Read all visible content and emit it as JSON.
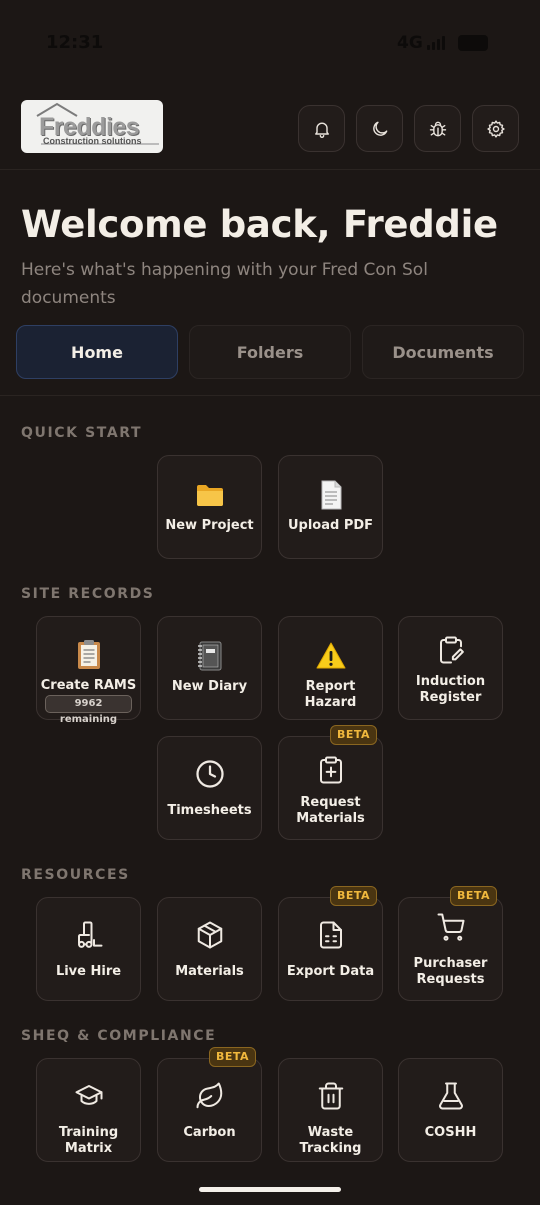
{
  "status_bar": {
    "time": "12:31",
    "network": "4G"
  },
  "header": {
    "logo": {
      "name": "Freddies",
      "tagline": "Construction solutions"
    },
    "buttons": [
      {
        "name": "notifications-button",
        "icon": "bell-icon"
      },
      {
        "name": "dark-mode-button",
        "icon": "moon-icon"
      },
      {
        "name": "bug-report-button",
        "icon": "bug-icon"
      },
      {
        "name": "settings-button",
        "icon": "gear-icon"
      }
    ]
  },
  "welcome": {
    "title": "Welcome back, Freddie",
    "subtitle": "Here's what's happening with your Fred Con Sol documents"
  },
  "tabs": [
    {
      "label": "Home",
      "active": true
    },
    {
      "label": "Folders",
      "active": false
    },
    {
      "label": "Documents",
      "active": false
    }
  ],
  "sections": {
    "quick_start": {
      "title": "QUICK START",
      "items": [
        {
          "label": "New Project",
          "icon": "folder-icon"
        },
        {
          "label": "Upload PDF",
          "icon": "document-icon"
        }
      ]
    },
    "site_records": {
      "title": "SITE RECORDS",
      "items": [
        {
          "label": "Create RAMS",
          "icon": "clipboard-icon",
          "badge": "9962 remaining"
        },
        {
          "label": "New Diary",
          "icon": "notebook-icon"
        },
        {
          "label": "Report Hazard",
          "icon": "warning-icon"
        },
        {
          "label": "Induction Register",
          "icon": "clipboard-edit-icon"
        },
        {
          "label": "Timesheets",
          "icon": "clock-icon"
        },
        {
          "label": "Request Materials",
          "icon": "clipboard-plus-icon",
          "beta": "BETA"
        }
      ]
    },
    "resources": {
      "title": "RESOURCES",
      "items": [
        {
          "label": "Live Hire",
          "icon": "forklift-icon"
        },
        {
          "label": "Materials",
          "icon": "box-icon"
        },
        {
          "label": "Export Data",
          "icon": "spreadsheet-icon",
          "beta": "BETA"
        },
        {
          "label": "Purchaser Requests",
          "icon": "cart-icon",
          "beta": "BETA"
        }
      ]
    },
    "sheq": {
      "title": "SHEQ & COMPLIANCE",
      "items": [
        {
          "label": "Training Matrix",
          "icon": "graduation-cap-icon"
        },
        {
          "label": "Carbon",
          "icon": "leaf-icon",
          "beta": "BETA"
        },
        {
          "label": "Waste Tracking",
          "icon": "trash-icon"
        },
        {
          "label": "COSHH",
          "icon": "flask-icon"
        }
      ]
    }
  },
  "colors": {
    "background": "#1c1715",
    "card": "#221c1a",
    "card_border": "#3a3230",
    "active_tab": "#1b2233",
    "beta_text": "#f0b83d",
    "beta_bg": "#4a3511"
  }
}
